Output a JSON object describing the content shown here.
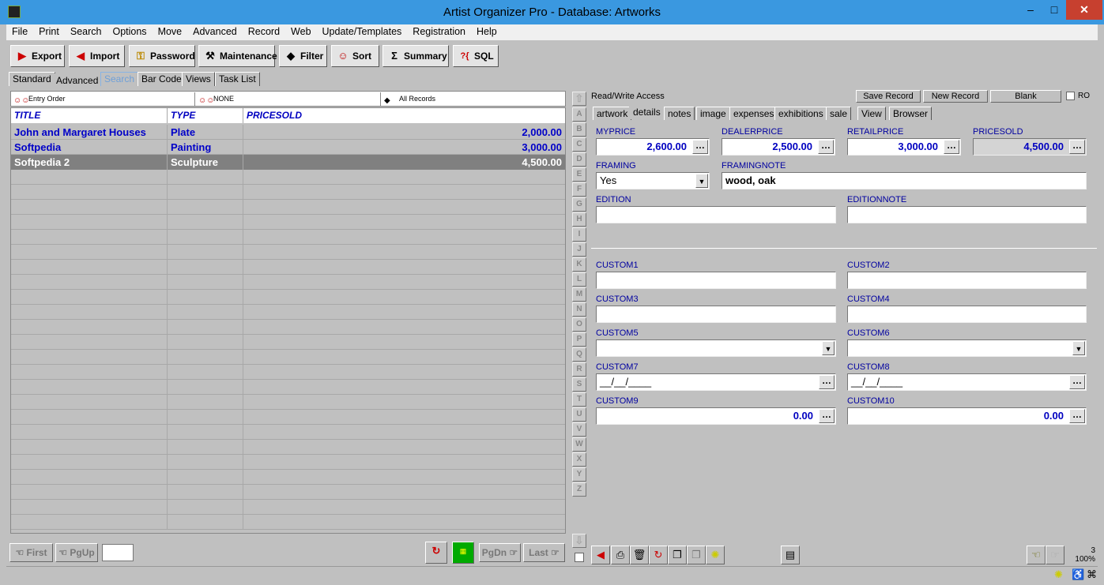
{
  "window": {
    "title": "Artist Organizer Pro - Database: Artworks",
    "minimize": "‒",
    "maximize": "□",
    "close": "✕"
  },
  "menu": [
    "File",
    "Print",
    "Search",
    "Options",
    "Move",
    "Advanced",
    "Record",
    "Web",
    "Update/Templates",
    "Registration",
    "Help"
  ],
  "toolbar": [
    {
      "label": "Export",
      "icon": "export-icon",
      "glyph": "▶"
    },
    {
      "label": "Import",
      "icon": "import-icon",
      "glyph": "◀"
    },
    {
      "label": "Password",
      "icon": "key-icon",
      "glyph": "⚿"
    },
    {
      "label": "Maintenance",
      "icon": "hammer-icon",
      "glyph": "⚒"
    },
    {
      "label": "Filter",
      "icon": "filter-icon",
      "glyph": "◆"
    },
    {
      "label": "Sort",
      "icon": "sort-people-icon",
      "glyph": "☺"
    },
    {
      "label": "Summary",
      "icon": "sigma-icon",
      "glyph": "Σ"
    },
    {
      "label": "SQL",
      "icon": "sql-icon",
      "glyph": "?{"
    }
  ],
  "view_tabs": [
    "Standard",
    "Advanced",
    "Search",
    "Bar Code",
    "Views",
    "Task List"
  ],
  "grid_bar": {
    "order": "Entry Order",
    "sort": "NONE",
    "filter": "All Records"
  },
  "grid": {
    "columns": [
      "TITLE",
      "TYPE",
      "PRICESOLD"
    ],
    "rows": [
      {
        "title": "John and Margaret Houses",
        "type": "Plate",
        "price": "2,000.00"
      },
      {
        "title": "Softpedia",
        "type": "Painting",
        "price": "3,000.00"
      },
      {
        "title": "Softpedia 2",
        "type": "Sculpture",
        "price": "4,500.00"
      }
    ]
  },
  "alphabet": [
    "A",
    "B",
    "C",
    "D",
    "E",
    "F",
    "G",
    "H",
    "I",
    "J",
    "K",
    "L",
    "M",
    "N",
    "O",
    "P",
    "Q",
    "R",
    "S",
    "T",
    "U",
    "V",
    "W",
    "X",
    "Y",
    "Z"
  ],
  "nav": {
    "first": "First",
    "pgup": "PgUp",
    "pgdn": "PgDn",
    "last": "Last"
  },
  "record": {
    "access": "Read/Write Access",
    "save": "Save Record",
    "new": "New Record",
    "blank": "Blank",
    "ro": "RO"
  },
  "detail_tabs": [
    "artwork",
    "details",
    "notes",
    "image",
    "expenses",
    "exhibitions",
    "sale",
    "View",
    "Browser"
  ],
  "fields": {
    "myprice": {
      "label": "MYPRICE",
      "value": "2,600.00"
    },
    "dealerprice": {
      "label": "DEALERPRICE",
      "value": "2,500.00"
    },
    "retailprice": {
      "label": "RETAILPRICE",
      "value": "3,000.00"
    },
    "pricesold": {
      "label": "PRICESOLD",
      "value": "4,500.00"
    },
    "framing": {
      "label": "FRAMING",
      "value": "Yes"
    },
    "framingnote": {
      "label": "FRAMINGNOTE",
      "value": "wood, oak"
    },
    "edition": {
      "label": "EDITION",
      "value": ""
    },
    "editionnote": {
      "label": "EDITIONNOTE",
      "value": ""
    },
    "custom1": {
      "label": "CUSTOM1",
      "value": ""
    },
    "custom2": {
      "label": "CUSTOM2",
      "value": ""
    },
    "custom3": {
      "label": "CUSTOM3",
      "value": ""
    },
    "custom4": {
      "label": "CUSTOM4",
      "value": ""
    },
    "custom5": {
      "label": "CUSTOM5",
      "value": ""
    },
    "custom6": {
      "label": "CUSTOM6",
      "value": ""
    },
    "custom7": {
      "label": "CUSTOM7",
      "value": "__/__/____"
    },
    "custom8": {
      "label": "CUSTOM8",
      "value": "__/__/____"
    },
    "custom9": {
      "label": "CUSTOM9",
      "value": "0.00"
    },
    "custom10": {
      "label": "CUSTOM10",
      "value": "0.00"
    }
  },
  "dots": "…",
  "status": {
    "count": "3",
    "zoom": "100%"
  }
}
